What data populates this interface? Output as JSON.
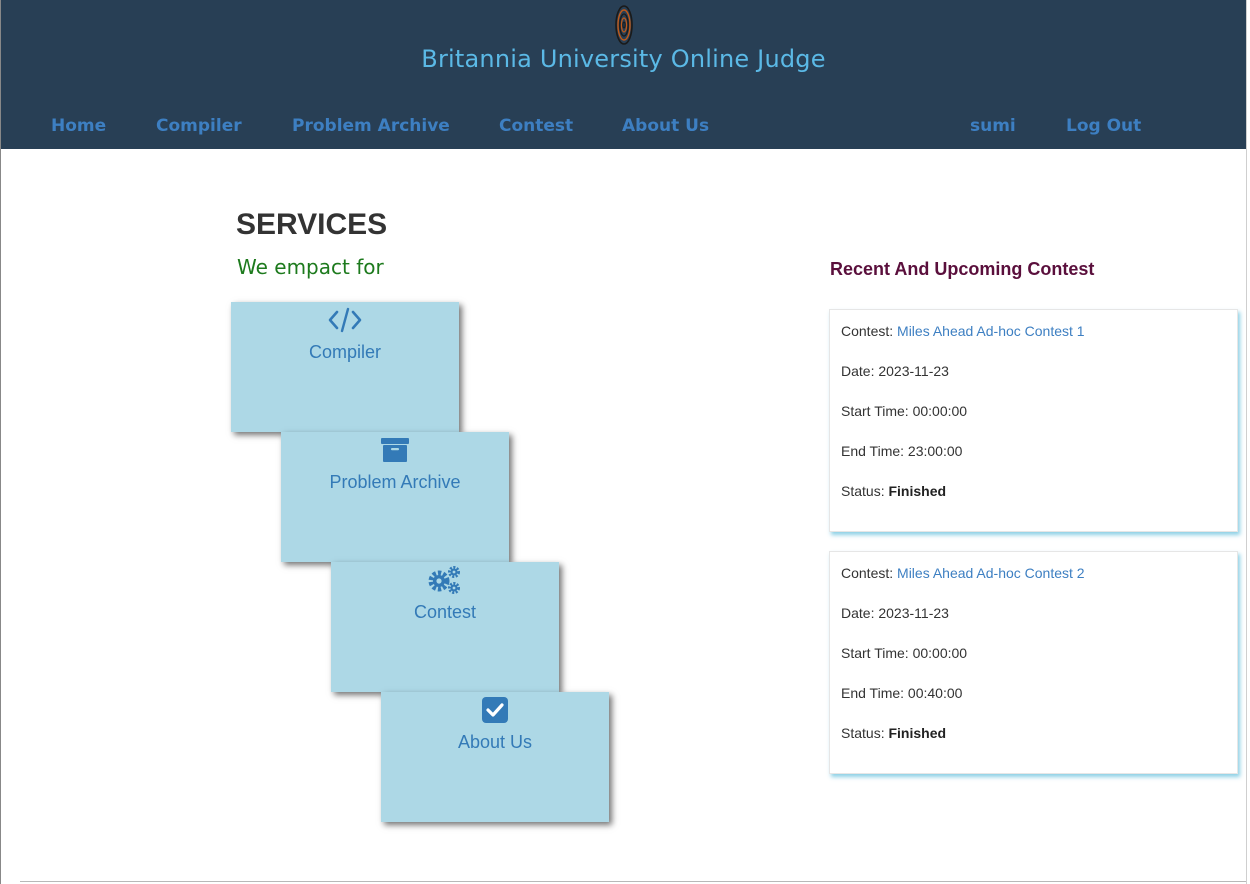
{
  "header": {
    "title": "Britannia University Online Judge",
    "nav": [
      "Home",
      "Compiler",
      "Problem Archive",
      "Contest",
      "About Us"
    ],
    "user": "sumi",
    "logout": "Log Out"
  },
  "services": {
    "title": "SERVICES",
    "subtitle": "We empact for",
    "cards": [
      {
        "label": "Compiler",
        "icon": "code-icon"
      },
      {
        "label": "Problem Archive",
        "icon": "archive-icon"
      },
      {
        "label": "Contest",
        "icon": "gears-icon"
      },
      {
        "label": "About Us",
        "icon": "check-square-icon"
      }
    ]
  },
  "contests": {
    "heading": "Recent And Upcoming Contest",
    "labels": {
      "contest": "Contest: ",
      "date": "Date: ",
      "start": "Start Time: ",
      "end": "End Time: ",
      "status": "Status: "
    },
    "items": [
      {
        "name": "Miles Ahead Ad-hoc Contest 1",
        "date": "2023-11-23",
        "start": "00:00:00",
        "end": "23:00:00",
        "status": "Finished"
      },
      {
        "name": "Miles Ahead Ad-hoc Contest 2",
        "date": "2023-11-23",
        "start": "00:00:00",
        "end": "00:40:00",
        "status": "Finished"
      }
    ]
  },
  "colors": {
    "header_bg": "#283f55",
    "title": "#5bb9e6",
    "nav": "#3d7fc2",
    "card_bg": "#add8e6",
    "subtitle": "#1d7a1d",
    "heading": "#5a0f3c"
  }
}
